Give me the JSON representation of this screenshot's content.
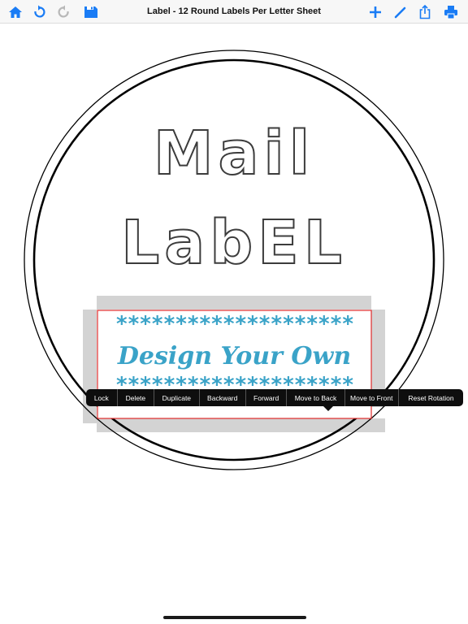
{
  "toolbar": {
    "title": "Label - 12 Round Labels Per Letter Sheet",
    "accent": "#1a7cf5",
    "disabled": "#b8b8b8",
    "left_icons": [
      "home-icon",
      "undo-icon",
      "redo-icon",
      "save-icon"
    ],
    "right_icons": [
      "add-icon",
      "edit-icon",
      "share-icon",
      "print-icon"
    ]
  },
  "label": {
    "line1": "Mail",
    "line2": "LabEL",
    "stars_top": "********************",
    "design_text": "Design Your Own",
    "stars_bottom": "********************",
    "text_color": "#3aa3c8",
    "selection_color": "#e02a2a"
  },
  "context_menu": {
    "items": [
      "Lock",
      "Delete",
      "Duplicate",
      "Backward",
      "Forward",
      "Move to Back",
      "Move to Front",
      "Reset Rotation"
    ]
  }
}
